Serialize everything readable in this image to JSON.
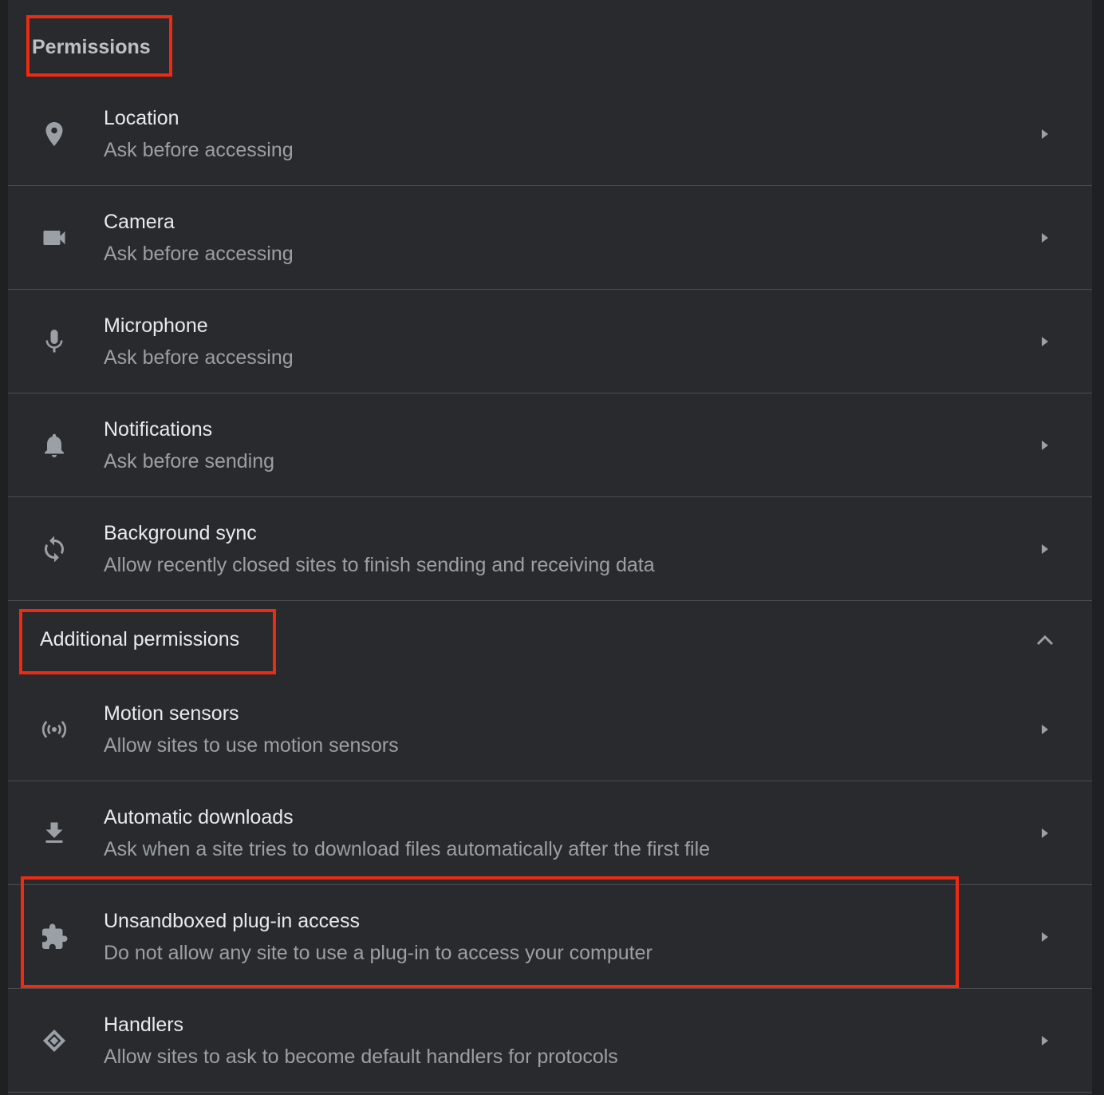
{
  "permissions": {
    "title": "Permissions",
    "items": [
      {
        "title": "Location",
        "subtitle": "Ask before accessing",
        "icon": "location-pin-icon"
      },
      {
        "title": "Camera",
        "subtitle": "Ask before accessing",
        "icon": "camera-icon"
      },
      {
        "title": "Microphone",
        "subtitle": "Ask before accessing",
        "icon": "microphone-icon"
      },
      {
        "title": "Notifications",
        "subtitle": "Ask before sending",
        "icon": "bell-icon"
      },
      {
        "title": "Background sync",
        "subtitle": "Allow recently closed sites to finish sending and receiving data",
        "icon": "sync-icon"
      }
    ]
  },
  "additional": {
    "title": "Additional permissions",
    "expanded": true,
    "items": [
      {
        "title": "Motion sensors",
        "subtitle": "Allow sites to use motion sensors",
        "icon": "sensors-icon"
      },
      {
        "title": "Automatic downloads",
        "subtitle": "Ask when a site tries to download files automatically after the first file",
        "icon": "download-icon"
      },
      {
        "title": "Unsandboxed plug-in access",
        "subtitle": "Do not allow any site to use a plug-in to access your computer",
        "icon": "puzzle-icon"
      },
      {
        "title": "Handlers",
        "subtitle": "Allow sites to ask to become default handlers for protocols",
        "icon": "handler-icon"
      }
    ]
  },
  "colors": {
    "background": "#292a2d",
    "text_primary": "#e8eaed",
    "text_secondary": "#9aa0a6",
    "icon": "#9aa0a6",
    "highlight": "#ee2a12"
  }
}
